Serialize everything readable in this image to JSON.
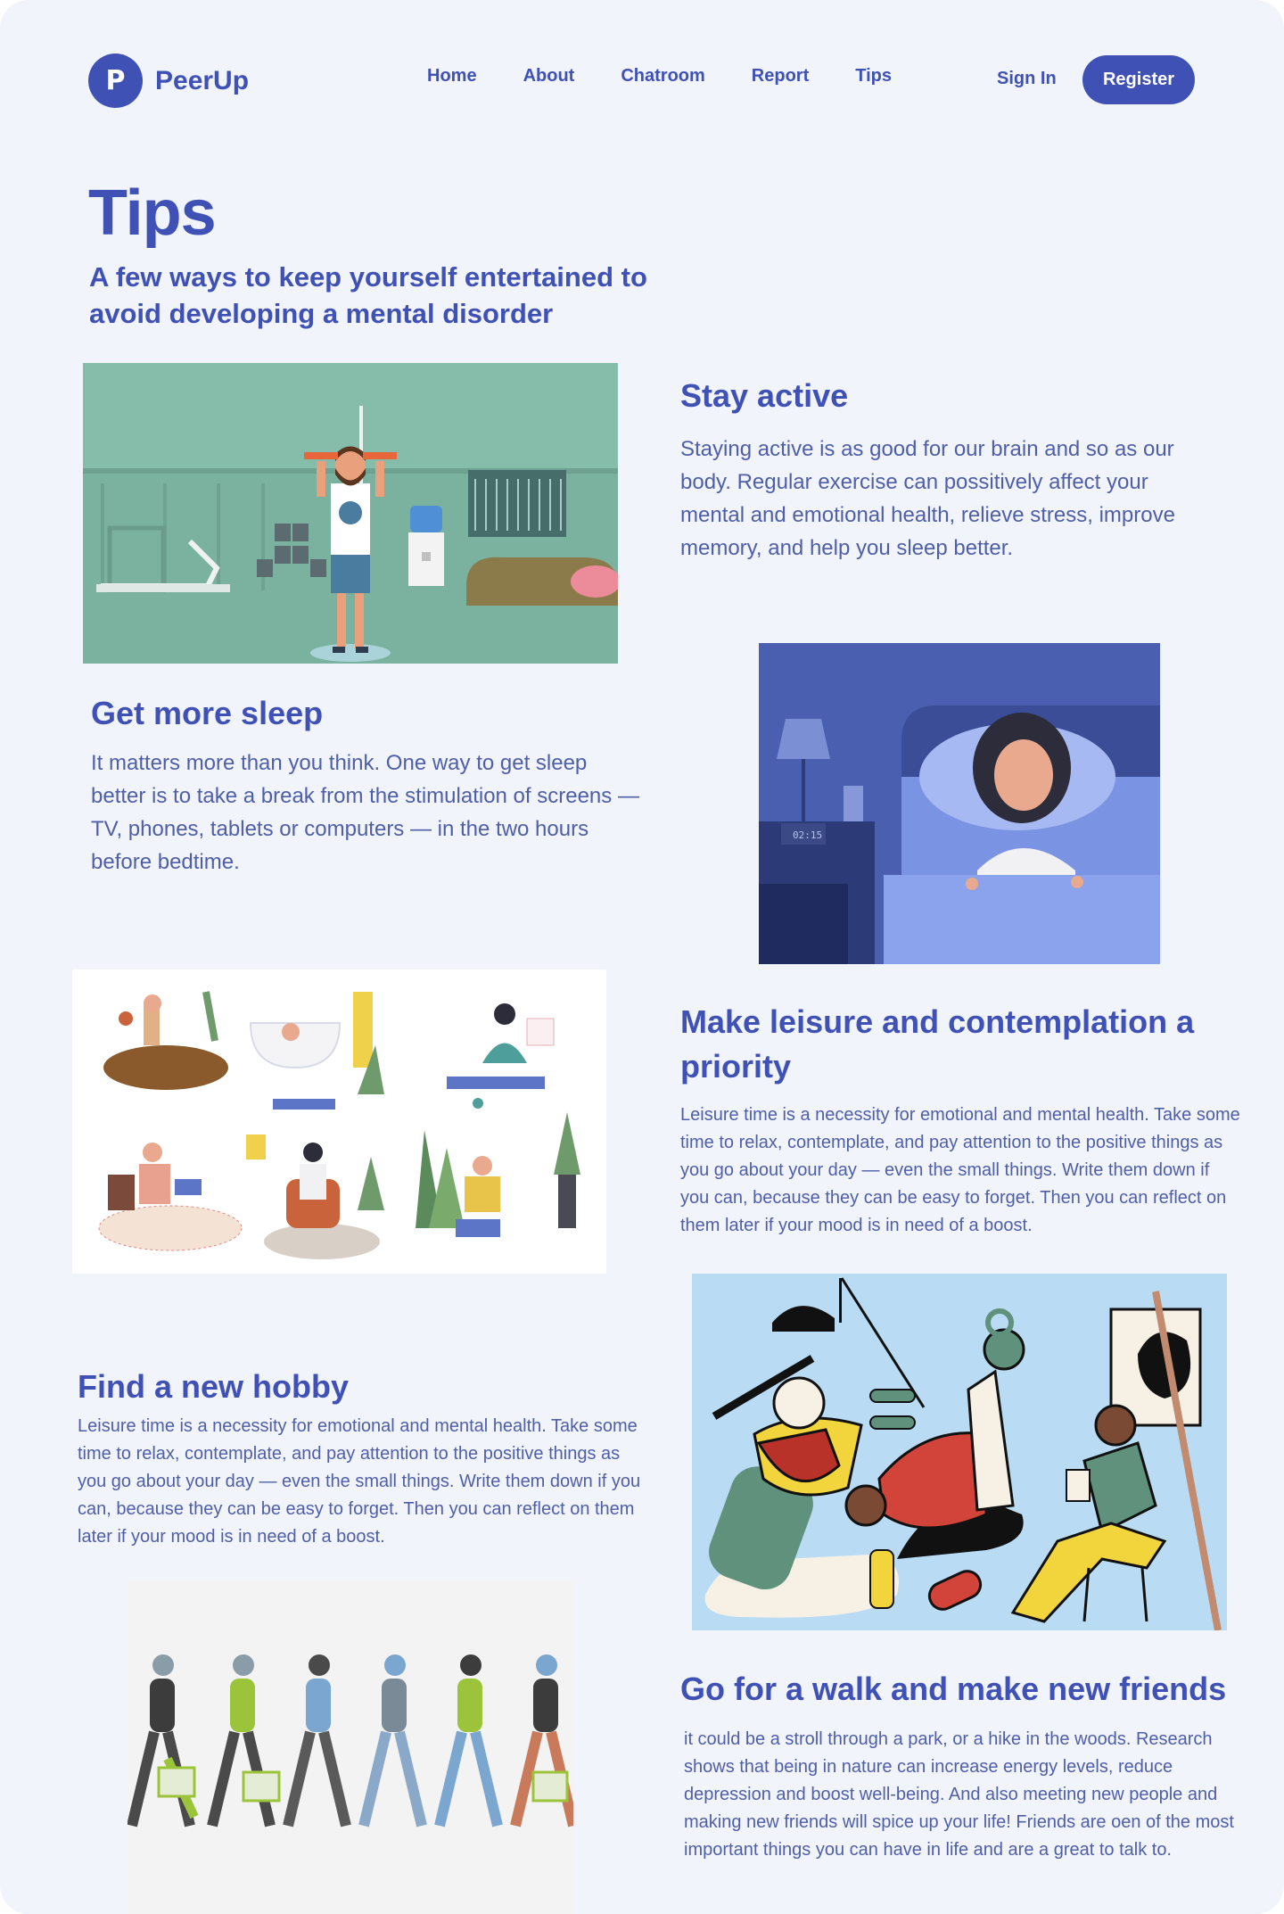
{
  "brand": {
    "logo_letter": "P",
    "name": "PeerUp"
  },
  "nav": [
    "Home",
    "About",
    "Chatroom",
    "Report",
    "Tips"
  ],
  "auth": {
    "sign_in": "Sign In",
    "register": "Register"
  },
  "hero": {
    "title": "Tips",
    "subtitle": "A few ways to keep yourself entertained to avoid developing a mental disorder"
  },
  "tips": [
    {
      "title": "Stay active",
      "body": "Staying active is as good for our brain and so as our body. Regular exercise can possitively affect your mental and emotional health, relieve stress, improve memory, and help you sleep better."
    },
    {
      "title": "Get more sleep",
      "body": "It matters more than you think. One way to get sleep better is to take a break from the stimulation of screens — TV,  phones, tablets or computers — in the two hours before bedtime."
    },
    {
      "title": "Make leisure and contemplation a priority",
      "body": "Leisure time is a necessity for emotional and mental health. Take some time to relax, contemplate, and pay attention to the positive things as you go about your day — even the small things. Write them down if you can, because they can be easy to forget. Then you can reflect on them later if your mood is in need of a boost."
    },
    {
      "title": "Find a new hobby",
      "body": "Leisure time is a necessity for emotional and mental health. Take some time to relax, contemplate, and pay attention to the positive things as you go about your day — even the small things. Write them down if you can, because they can be easy to forget. Then you can reflect on them later if your mood is in need of a boost."
    },
    {
      "title": "Go for a walk and make new friends",
      "body": "it could be a stroll through a park, or a hike in the woods. Research shows that being in nature can increase energy levels, reduce depression and boost well-being. And also meeting new people and  making new friends will spice up your life! Friends are oen of the most important things you can have in life and are a great to talk to."
    }
  ],
  "illustrations": {
    "clock_display": "02:15",
    "gym_icon": "exercise-illustration",
    "sleep_icon": "sleep-illustration",
    "leisure_icon": "leisure-illustration",
    "hobby_icon": "hobby-illustration",
    "walk_icon": "walking-people-illustration"
  },
  "colors": {
    "primary": "#3f51b5",
    "page_bg": "#f1f4fb",
    "text": "#4f5ea8",
    "gym_bg": "#86bcaa",
    "sleep_bg": "#4a5fb0",
    "hobby_bg": "#b9dcf4"
  }
}
